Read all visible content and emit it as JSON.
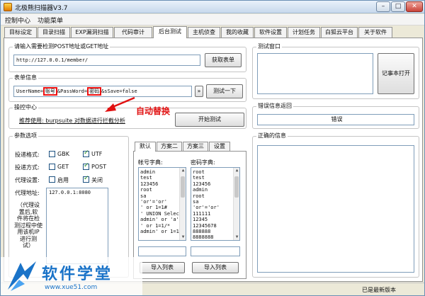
{
  "window": {
    "title": "北极熊扫描器V3.7"
  },
  "menu": {
    "items": [
      "控制中心",
      "功能菜单"
    ]
  },
  "tabs": [
    "目标设定",
    "目录扫描",
    "EXP漏洞扫描",
    "代码审计",
    "后台测试",
    "主机侦查",
    "我的收藏",
    "软件设置",
    "计划任务",
    "白狐云平台",
    "关于软件"
  ],
  "url_group": {
    "label": "请输入需要检测POST地址或GET地址",
    "value": "http://127.0.0.1/member/",
    "button": "获取表单"
  },
  "form_group": {
    "label": "表单信息",
    "prefix": "UserName=",
    "token1": "账号",
    "middle": "&PassWord=",
    "token2": "密码",
    "suffix": "&sSave=false",
    "expand_button": "»",
    "test_button": "测试一下",
    "annotation": "自动替换"
  },
  "control_group": {
    "label": "操控中心",
    "hint": "推荐使用: burpsuite 对数据进行拦截分析",
    "start_button": "开始测试"
  },
  "params_group": {
    "label": "参数选项",
    "encoding_label": "投递格式:",
    "gbk": "GBK",
    "utf": "UTF",
    "method_label": "投递方式:",
    "get": "GET",
    "post": "POST",
    "proxy_label": "代理设置:",
    "enable": "启用",
    "disable": "关闭",
    "address_label": "代理地址:",
    "address_value": "127.0.0.1:8080",
    "note_lines": [
      "（代理设",
      "置后,软",
      "件将在检",
      "测过程中使",
      "用该机IP",
      "进行测",
      "试）"
    ]
  },
  "dict_tabs": [
    "默认",
    "方案二",
    "方案三",
    "设置"
  ],
  "account_dict": {
    "label": "帐号字典:",
    "items": [
      "admin",
      "test",
      "123456",
      "root",
      "sa",
      "'or'='or'",
      "' or 1=1#",
      "' UNION Select",
      "admin' or 'a'=",
      "' or 1=1/*",
      "admin' or 1=1/*"
    ],
    "import_button": "导入列表"
  },
  "password_dict": {
    "label": "密码字典:",
    "items": [
      "root",
      "test",
      "123456",
      "admin",
      "root",
      "sa",
      "'or'='or'",
      "111111",
      "12345",
      "12345678",
      "888888",
      "8888888"
    ],
    "import_button": "导入列表"
  },
  "test_window": {
    "label": "测试窗口",
    "open_button": "记事本打开"
  },
  "error_group": {
    "label": "错误信息返回",
    "value": "错误"
  },
  "correct_group": {
    "label": "正确的信息"
  },
  "status": {
    "text": "已是最新版本"
  },
  "watermark": {
    "text": "软件学堂",
    "url": "www.xue51.com"
  },
  "colors": {
    "accent": "#e11111",
    "annotation": "#e11111",
    "watermark": "#1a73c8"
  }
}
